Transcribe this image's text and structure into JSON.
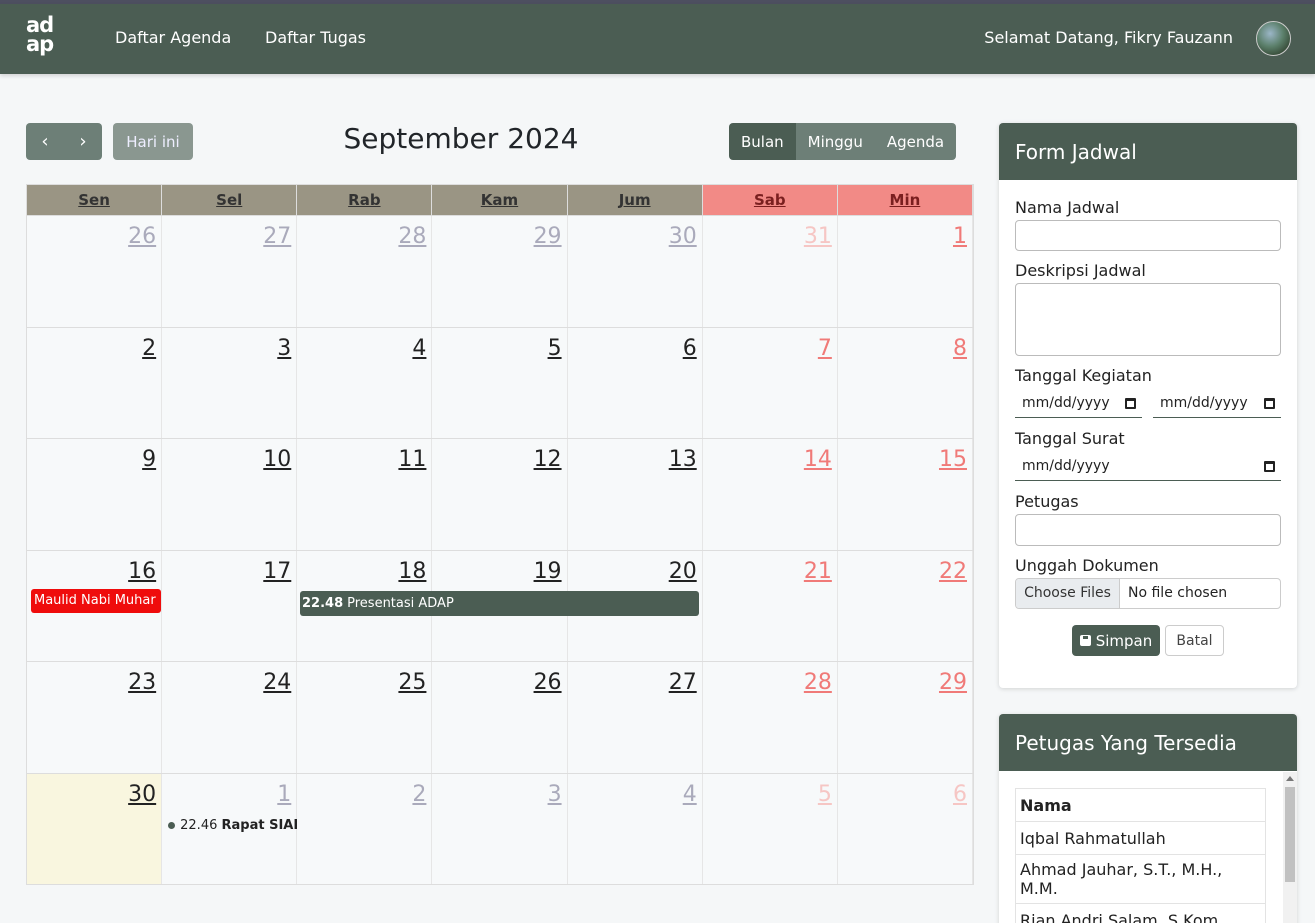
{
  "nav": {
    "logo_line1": "ad",
    "logo_line2": "ap",
    "links": [
      "Daftar Agenda",
      "Daftar Tugas"
    ],
    "welcome": "Selamat Datang, Fikry Fauzann"
  },
  "toolbar": {
    "prev_icon": "‹",
    "next_icon": "›",
    "today_label": "Hari ini",
    "title": "September 2024",
    "views": [
      "Bulan",
      "Minggu",
      "Agenda"
    ],
    "active_view": "Bulan"
  },
  "calendar": {
    "weekdays": [
      "Sen",
      "Sel",
      "Rab",
      "Kam",
      "Jum",
      "Sab",
      "Min"
    ],
    "weeks": [
      [
        {
          "d": "26",
          "other": true
        },
        {
          "d": "27",
          "other": true
        },
        {
          "d": "28",
          "other": true
        },
        {
          "d": "29",
          "other": true
        },
        {
          "d": "30",
          "other": true
        },
        {
          "d": "31",
          "other": true
        },
        {
          "d": "1",
          "other": false
        }
      ],
      [
        {
          "d": "2"
        },
        {
          "d": "3"
        },
        {
          "d": "4"
        },
        {
          "d": "5"
        },
        {
          "d": "6"
        },
        {
          "d": "7"
        },
        {
          "d": "8"
        }
      ],
      [
        {
          "d": "9"
        },
        {
          "d": "10"
        },
        {
          "d": "11"
        },
        {
          "d": "12"
        },
        {
          "d": "13"
        },
        {
          "d": "14"
        },
        {
          "d": "15"
        }
      ],
      [
        {
          "d": "16"
        },
        {
          "d": "17"
        },
        {
          "d": "18"
        },
        {
          "d": "19"
        },
        {
          "d": "20"
        },
        {
          "d": "21"
        },
        {
          "d": "22"
        }
      ],
      [
        {
          "d": "23"
        },
        {
          "d": "24"
        },
        {
          "d": "25"
        },
        {
          "d": "26"
        },
        {
          "d": "27"
        },
        {
          "d": "28"
        },
        {
          "d": "29"
        }
      ],
      [
        {
          "d": "30",
          "today": true
        },
        {
          "d": "1",
          "other": true
        },
        {
          "d": "2",
          "other": true
        },
        {
          "d": "3",
          "other": true
        },
        {
          "d": "4",
          "other": true
        },
        {
          "d": "5",
          "other": true
        },
        {
          "d": "6",
          "other": true
        }
      ]
    ],
    "events": {
      "holiday": "Maulid Nabi Muhar",
      "presentasi_time": "22.48",
      "presentasi_title": "Presentasi ADAP",
      "rapat_time": "22.46",
      "rapat_title": "Rapat SIAP"
    },
    "colors": {
      "primary": "#4b5d53",
      "holiday": "#ef0c0c",
      "weekend": "#f28a86",
      "today": "#f9f6df"
    }
  },
  "form": {
    "title": "Form Jadwal",
    "nama_label": "Nama Jadwal",
    "nama_value": "",
    "deskripsi_label": "Deskripsi Jadwal",
    "deskripsi_value": "",
    "tanggal_kegiatan_label": "Tanggal Kegiatan",
    "tanggal_kegiatan_start": "mm/dd/yyyy",
    "tanggal_kegiatan_end": "mm/dd/yyyy",
    "tanggal_surat_label": "Tanggal Surat",
    "tanggal_surat_value": "mm/dd/yyyy",
    "petugas_label": "Petugas",
    "petugas_value": "",
    "unggah_label": "Unggah Dokumen",
    "choose_files": "Choose Files",
    "no_file": "No file chosen",
    "save_label": "Simpan",
    "cancel_label": "Batal"
  },
  "staff": {
    "title": "Petugas Yang Tersedia",
    "header": "Nama",
    "rows": [
      "Iqbal Rahmatullah",
      "Ahmad Jauhar, S.T., M.H., M.M.",
      "Rian Andri Salam, S.Kom,"
    ]
  }
}
